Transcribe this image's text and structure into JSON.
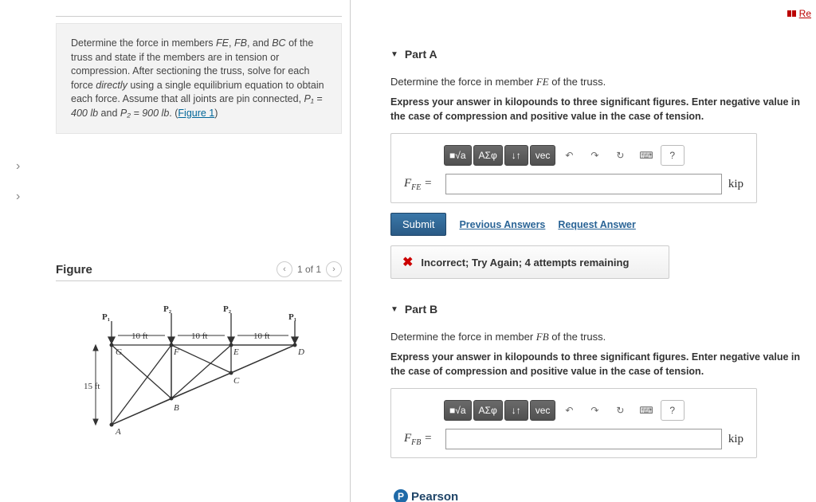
{
  "top_link": "Re",
  "problem": {
    "text1": "Determine the force in members ",
    "m1": "FE",
    "m2": "FB",
    "m3": "BC",
    "text2": " of the truss and state if the members are in tension or compression. After sectioning the truss, solve for each force ",
    "directly": "directly",
    "text3": " using a single equilibrium equation to obtain each force. Assume that all joints are pin connected, ",
    "p1eq": "P₁ = 400 lb",
    "and": " and ",
    "p2eq": "P₂ = 900 lb",
    "period": ". (",
    "figlink": "Figure 1",
    "close": ")"
  },
  "figure": {
    "title": "Figure",
    "pager": "1 of 1",
    "labels": {
      "P1": "P₁",
      "P2": "P₂",
      "d10": "10 ft",
      "d15": "15 ft",
      "G": "G",
      "F": "F",
      "E": "E",
      "D": "D",
      "C": "C",
      "B": "B",
      "A": "A"
    }
  },
  "partA": {
    "title": "Part A",
    "prompt1": "Determine the force in member ",
    "member": "FE",
    "prompt2": " of the truss.",
    "instr": "Express your answer in kilopounds to three significant figures. Enter negative value in the case of compression and positive value in the case of tension.",
    "lhs_main": "F",
    "lhs_sub": "FE",
    "eq": " =",
    "unit": "kip",
    "submit": "Submit",
    "prev": "Previous Answers",
    "req": "Request Answer",
    "fb": "Incorrect; Try Again; 4 attempts remaining"
  },
  "partB": {
    "title": "Part B",
    "prompt1": "Determine the force in member ",
    "member": "FB",
    "prompt2": " of the truss.",
    "instr": "Express your answer in kilopounds to three significant figures. Enter negative value in the case of compression and positive value in the case of tension.",
    "lhs_main": "F",
    "lhs_sub": "FB",
    "eq": " =",
    "unit": "kip"
  },
  "toolbar": {
    "t1": "■√a",
    "t2": "ΑΣφ",
    "t3": "↓↑",
    "t4": "vec",
    "undo": "↶",
    "redo": "↷",
    "reset": "↻",
    "kb": "⌨",
    "help": "?"
  },
  "footer": "Pearson"
}
